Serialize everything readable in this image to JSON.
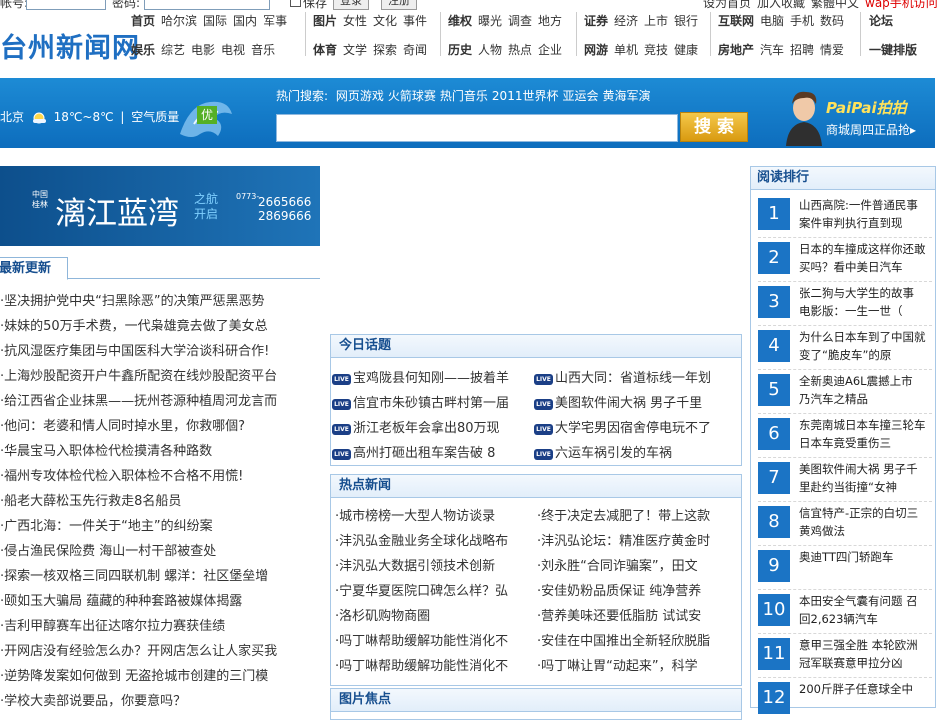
{
  "top": {
    "account_label": "帐号:",
    "password_label": "密码:",
    "save_label": "保存",
    "login_btn": "登录",
    "register_btn": "注册",
    "set_home": "设为首页",
    "add_fav": "加入收藏",
    "simple_chinese": "繁體中文",
    "wap": "wap手机访问"
  },
  "logo": "台州新闻网",
  "nav": {
    "groups": [
      {
        "row1": [
          "首页",
          "哈尔滨",
          "国际",
          "国内",
          "军事"
        ],
        "row2": [
          "娱乐",
          "综艺",
          "电影",
          "电视",
          "音乐"
        ]
      },
      {
        "row1": [
          "图片",
          "女性",
          "文化",
          "事件"
        ],
        "row2": [
          "体育",
          "文学",
          "探索",
          "奇闻"
        ]
      },
      {
        "row1": [
          "维权",
          "曝光",
          "调查",
          "地方"
        ],
        "row2": [
          "历史",
          "人物",
          "热点",
          "企业"
        ]
      },
      {
        "row1": [
          "证券",
          "经济",
          "上市",
          "银行"
        ],
        "row2": [
          "网游",
          "单机",
          "竞技",
          "健康"
        ]
      },
      {
        "row1": [
          "互联网",
          "电脑",
          "手机",
          "数码"
        ],
        "row2": [
          "房地产",
          "汽车",
          "招聘",
          "情爱"
        ]
      },
      {
        "row1": [
          "论坛"
        ],
        "row2": [
          "一键排版"
        ]
      }
    ]
  },
  "banner": {
    "city": "北京",
    "temp": "18℃~8℃",
    "aq_label": "空气质量",
    "aq_value": "优",
    "hot_label": "热门搜索:",
    "hot_terms": [
      "网页游戏",
      "火箭球赛",
      "热门音乐",
      "2011世界杯",
      "亚运会",
      "黄海军演"
    ],
    "search_placeholder": "",
    "search_btn": "搜 索",
    "paipai": "PaiPai拍拍",
    "paipai_sub": "商城周四正品抢▸"
  },
  "ad": {
    "badge_top": "中国",
    "badge_bottom": "桂林",
    "title": "漓江蓝湾",
    "subtitle_top": "之航",
    "subtitle_bottom": "开启",
    "area": "0773-",
    "phone1": "2665666",
    "phone2": "2869666"
  },
  "latest": {
    "tab": "最新更新",
    "items": [
      "·坚决拥护党中央“扫黑除恶”的决策严惩黑恶势",
      "·妹妹的50万手术费，一代枭雄竟去做了美女总",
      "·抗风湿医疗集团与中国医科大学洽谈科研合作!",
      "·上海炒股配资开户牛鑫所配资在线炒股配资平台",
      "·给江西省企业抹黑——抚州苍源种植周河龙言而",
      "·他问：老婆和情人同时掉水里，你救哪個?",
      "·华晨宝马入职体检代检摸清各种路数",
      "·福州专攻体检代检入职体检不合格不用慌!",
      "·船老大薛松玉先行救走8名船员",
      "·广西北海：一件关于“地主”的纠纷案",
      "·侵占渔民保险费  海山一村干部被查处",
      "·探索一核双格三同四联机制  螺洋：社区堡垒增",
      "·颐如玉大骗局 蕴藏的种种套路被媒体揭露",
      "·吉利甲醇赛车出征达喀尔拉力赛获佳绩",
      "·开网店没有经验怎么办？开网店怎么让人家买我",
      "·逆势降发案如何做到 无盗抢城市创建的三门模",
      "·学校大卖部说要品，你要意吗？"
    ]
  },
  "today": {
    "title": "今日话题",
    "left": [
      "宝鸡陇县何知刚——披着羊",
      "信宜市朱砂镇古畔村第一届",
      "浙江老板年会拿出80万现",
      "高州打砸出租车案告破 8"
    ],
    "right": [
      "山西大同：省道标线一年划",
      "美图软件闹大祸 男子千里",
      "大学宅男因宿舍停电玩不了",
      "六运车祸引发的车祸"
    ]
  },
  "hotnews": {
    "title": "热点新闻",
    "left": [
      "·城市榜榜一大型人物访谈录",
      "·沣汎弘金融业务全球化战略布",
      "·沣汎弘大数据引领技术创新",
      "·宁夏华夏医院口碑怎么样？弘",
      "·洛杉矶购物商圈",
      "·吗丁啉帮助缓解功能性消化不",
      "·吗丁啉帮助缓解功能性消化不"
    ],
    "right": [
      "·终于决定去减肥了！带上这款",
      "·沣汎弘论坛：精准医疗黄金时",
      "·刘永胜“合同诈骗案”，田文",
      "·安佳奶粉品质保证 纯净营养",
      "·营养美味还要低脂肪 试试安",
      "·安佳在中国推出全新轻欣脱脂",
      "·吗丁啉让胃“动起来”，科学"
    ]
  },
  "photo": {
    "title": "图片焦点"
  },
  "rank": {
    "title": "阅读排行",
    "items": [
      {
        "n": "1",
        "t": "山西高院:一件普通民事案件审判执行直到现"
      },
      {
        "n": "2",
        "t": "日本的车撞成这样你还敢买吗？看中美日汽车"
      },
      {
        "n": "3",
        "t": "张二狗与大学生的故事 电影版：一生一世（"
      },
      {
        "n": "4",
        "t": "为什么日本车到了中国就变了“脆皮车”的原"
      },
      {
        "n": "5",
        "t": "全新奥迪A6L震撼上市 乃汽车之精品"
      },
      {
        "n": "6",
        "t": "东莞南城日本车撞三轮车 日本车竟受重伤三"
      },
      {
        "n": "7",
        "t": "美图软件闹大祸 男子千里赴约当街撞“女神"
      },
      {
        "n": "8",
        "t": "信宜特产-正宗的白切三黄鸡做法"
      },
      {
        "n": "9",
        "t": "奥迪TT四门轿跑车"
      },
      {
        "n": "10",
        "t": "本田安全气囊有问题 召回2,623辆汽车"
      },
      {
        "n": "11",
        "t": "意甲三强全胜 本轮欧洲冠军联赛意甲拉分凶"
      },
      {
        "n": "12",
        "t": "200斤胖子任意球全中"
      }
    ]
  }
}
